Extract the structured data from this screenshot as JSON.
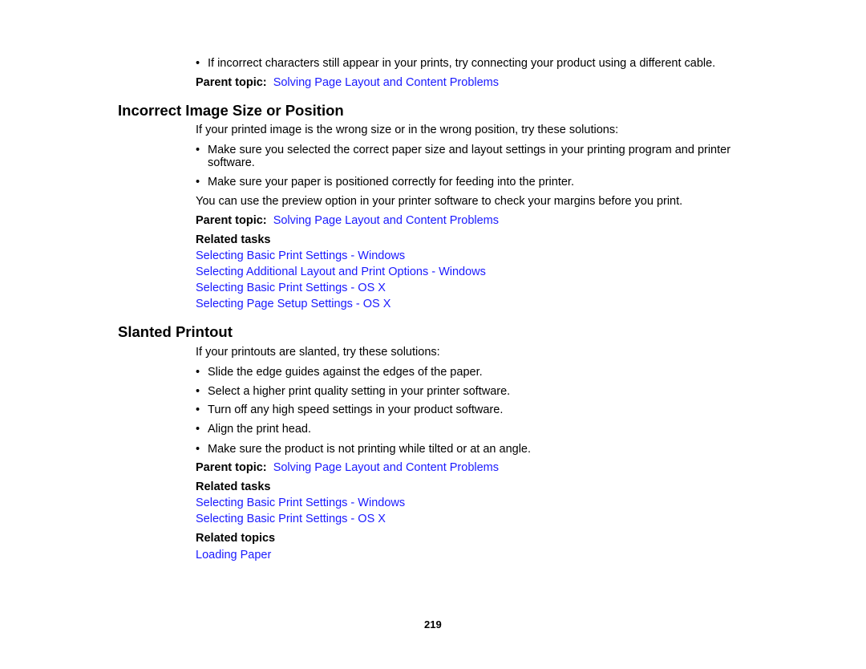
{
  "top": {
    "bullet": "If incorrect characters still appear in your prints, try connecting your product using a different cable.",
    "parent_label": "Parent topic:",
    "parent_link": "Solving Page Layout and Content Problems"
  },
  "section1": {
    "title": "Incorrect Image Size or Position",
    "intro": "If your printed image is the wrong size or in the wrong position, try these solutions:",
    "bullets": [
      "Make sure you selected the correct paper size and layout settings in your printing program and printer",
      "software.",
      "Make sure your paper is positioned correctly for feeding into the printer."
    ],
    "note": "You can use the preview option in your printer software to check your margins before you print.",
    "parent_label": "Parent topic:",
    "parent_link": "Solving Page Layout and Content Problems",
    "related_tasks_label": "Related tasks",
    "related_tasks": [
      "Selecting Basic Print Settings - Windows",
      "Selecting Additional Layout and Print Options - Windows",
      "Selecting Basic Print Settings - OS X",
      "Selecting Page Setup Settings - OS X"
    ]
  },
  "section2": {
    "title": "Slanted Printout",
    "intro": "If your printouts are slanted, try these solutions:",
    "bullets": [
      "Slide the edge guides against the edges of the paper.",
      "Select a higher print quality setting in your printer software.",
      "Turn off any high speed settings in your product software.",
      "Align the print head.",
      "Make sure the product is not printing while tilted or at an angle."
    ],
    "parent_label": "Parent topic:",
    "parent_link": "Solving Page Layout and Content Problems",
    "related_tasks_label": "Related tasks",
    "related_tasks": [
      "Selecting Basic Print Settings - Windows",
      "Selecting Basic Print Settings - OS X"
    ],
    "related_topics_label": "Related topics",
    "related_topics": [
      "Loading Paper"
    ]
  },
  "footer": {
    "page_number": "219"
  },
  "bullet_glyph": "•",
  "colors": {
    "link": "#1a1aff",
    "text": "#000000"
  }
}
